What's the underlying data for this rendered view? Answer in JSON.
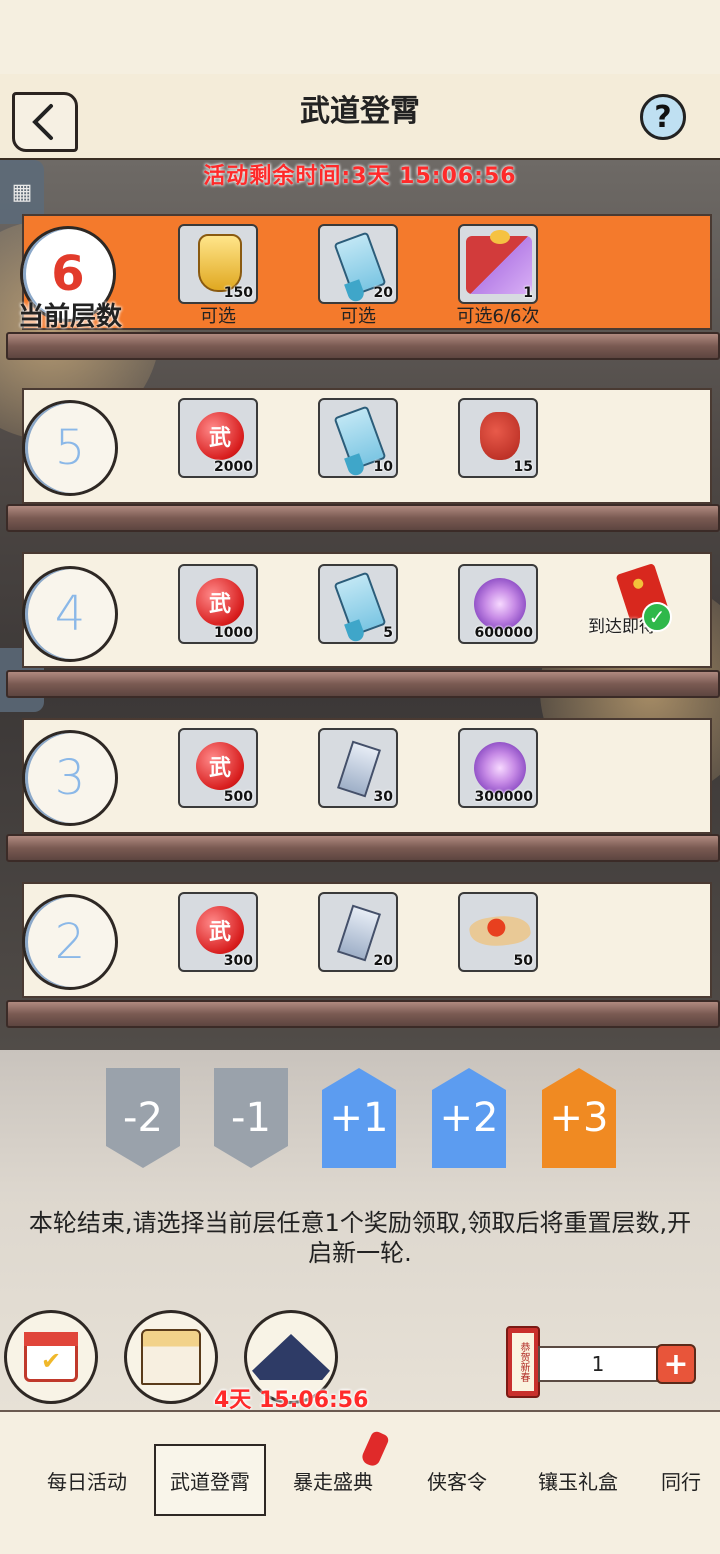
{
  "header": {
    "title": "武道登霄"
  },
  "timer_label": "活动剩余时间:3天 15:06:56",
  "current_floor": {
    "number": "6",
    "label": "当前层数"
  },
  "floors": [
    {
      "number": "6",
      "items": [
        {
          "icon": "gold-medal-icon",
          "qty": "150",
          "label": "可选"
        },
        {
          "icon": "blue-token-icon",
          "qty": "20",
          "label": "可选"
        },
        {
          "icon": "gift-box-icon",
          "qty": "1",
          "label": "可选6/6次"
        }
      ]
    },
    {
      "number": "5",
      "items": [
        {
          "icon": "red-coin-icon",
          "qty": "2000"
        },
        {
          "icon": "blue-token-icon",
          "qty": "10"
        },
        {
          "icon": "red-bag-icon",
          "qty": "15"
        }
      ]
    },
    {
      "number": "4",
      "items": [
        {
          "icon": "red-coin-icon",
          "qty": "1000"
        },
        {
          "icon": "blue-token-icon",
          "qty": "5"
        },
        {
          "icon": "purple-orb-icon",
          "qty": "600000"
        }
      ],
      "extra_label": "到达即得"
    },
    {
      "number": "3",
      "items": [
        {
          "icon": "red-coin-icon",
          "qty": "500"
        },
        {
          "icon": "scroll-icon",
          "qty": "30"
        },
        {
          "icon": "purple-orb-icon",
          "qty": "300000"
        }
      ]
    },
    {
      "number": "2",
      "items": [
        {
          "icon": "red-coin-icon",
          "qty": "300"
        },
        {
          "icon": "scroll-icon",
          "qty": "20"
        },
        {
          "icon": "pellet-icon",
          "qty": "50"
        }
      ]
    }
  ],
  "coin_glyph": "武",
  "dice": [
    "-2",
    "-1",
    "+1",
    "+2",
    "+3"
  ],
  "message": "本轮结束,请选择当前层任意1个奖励领取,领取后将重置层数,开启新一轮.",
  "bottom": {
    "timer": "4天 15:06:56",
    "coupon_text": "恭贺新春",
    "count": "1"
  },
  "tabs": [
    "每日活动",
    "武道登霄",
    "暴走盛典",
    "侠客令",
    "镶玉礼盒",
    "同行"
  ],
  "colors": {
    "accent": "#f47a2c",
    "red": "#ff2a2a",
    "blue": "#5c9cf0",
    "orange": "#f08a22"
  }
}
